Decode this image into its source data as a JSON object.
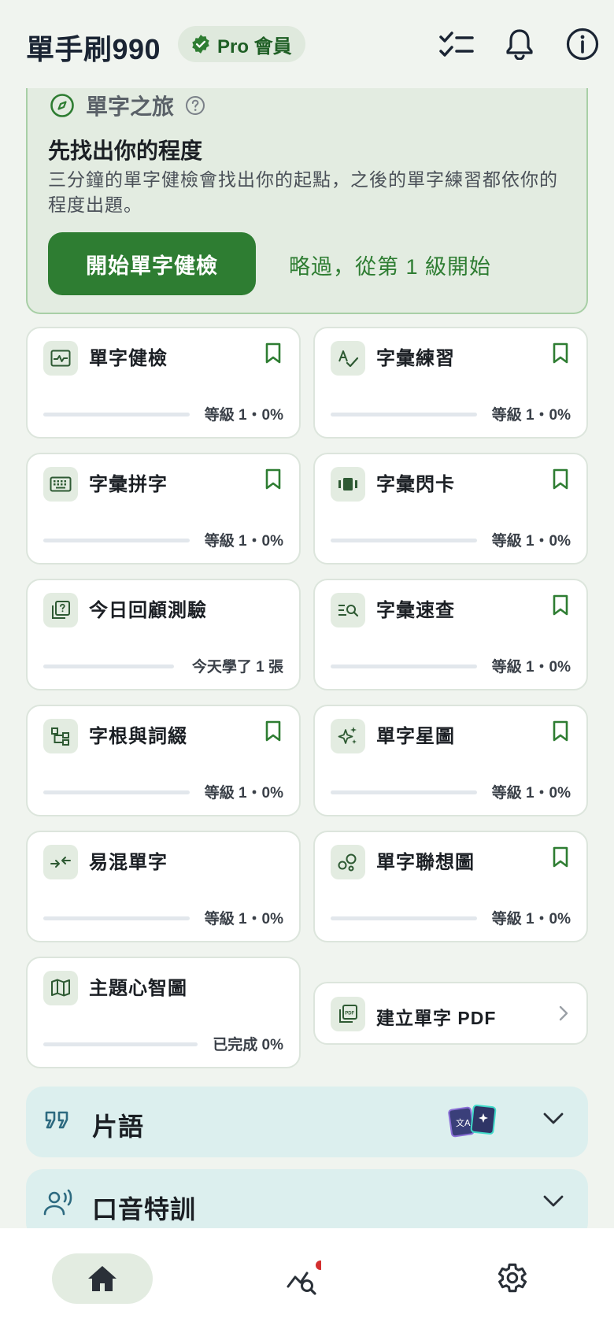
{
  "header": {
    "app_title": "單手刷990",
    "pro_badge": "Pro 會員",
    "icons": [
      "checklist-icon",
      "bell-icon",
      "info-icon"
    ]
  },
  "journey": {
    "label": "單字之旅",
    "title": "先找出你的程度",
    "description": "三分鐘的單字健檢會找出你的起點，之後的單字練習都依你的程度出題。",
    "start_button": "開始單字健檢",
    "skip_link": "略過，從第 1 級開始"
  },
  "cards": [
    {
      "title": "單字健檢",
      "status": "等級 1・0%",
      "icon": "pulse-icon",
      "bookmark": true
    },
    {
      "title": "字彙練習",
      "status": "等級 1・0%",
      "icon": "spellcheck-icon",
      "bookmark": true
    },
    {
      "title": "字彙拼字",
      "status": "等級 1・0%",
      "icon": "keyboard-icon",
      "bookmark": true
    },
    {
      "title": "字彙閃卡",
      "status": "等級 1・0%",
      "icon": "flashcards-icon",
      "bookmark": true
    },
    {
      "title": "今日回顧測驗",
      "status": "今天學了 1 張",
      "icon": "quiz-icon",
      "bookmark": false
    },
    {
      "title": "字彙速查",
      "status": "等級 1・0%",
      "icon": "search-list-icon",
      "bookmark": true
    },
    {
      "title": "字根與詞綴",
      "status": "等級 1・0%",
      "icon": "tree-icon",
      "bookmark": true
    },
    {
      "title": "單字星圖",
      "status": "等級 1・0%",
      "icon": "sparkle-icon",
      "bookmark": true
    },
    {
      "title": "易混單字",
      "status": "等級 1・0%",
      "icon": "compare-arrows-icon",
      "bookmark": false
    },
    {
      "title": "單字聯想圖",
      "status": "等級 1・0%",
      "icon": "bubbles-icon",
      "bookmark": true
    },
    {
      "title": "主題心智圖",
      "status": "已完成 0%",
      "icon": "map-icon",
      "bookmark": false
    }
  ],
  "pdf_card": {
    "title": "建立單字 PDF"
  },
  "sections": [
    {
      "label": "片語",
      "icon": "quote-icon"
    },
    {
      "label": "口音特訓",
      "icon": "voice-icon"
    }
  ],
  "bottom_nav": [
    "home-icon",
    "stats-search-icon",
    "settings-icon"
  ],
  "colors": {
    "accent": "#2e7d32",
    "background": "#f0f4ef",
    "section_bg": "#dcefee"
  }
}
